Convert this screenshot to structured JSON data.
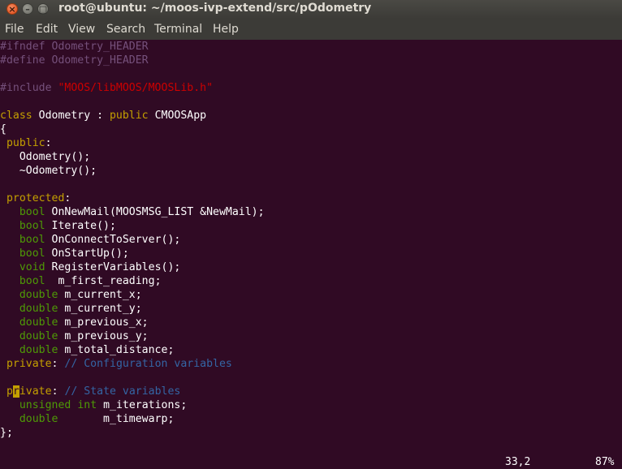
{
  "window": {
    "title": "root@ubuntu: ~/moos-ivp-extend/src/pOdometry",
    "close_glyph": "×",
    "minimize_glyph": "–",
    "maximize_glyph": "□"
  },
  "menu": {
    "file": "File",
    "edit": "Edit",
    "view": "View",
    "search": "Search",
    "terminal": "Terminal",
    "help": "Help"
  },
  "editor": {
    "colors": {
      "background": "#300a24",
      "preprocessor": "#75507b",
      "string": "#cc0000",
      "keyword": "#c4a000",
      "type": "#4e9a06",
      "comment": "#3465a4",
      "text": "#ffffff"
    },
    "lines": [
      [
        {
          "c": "pp",
          "t": "#ifndef Odometry_HEADER"
        }
      ],
      [
        {
          "c": "pp",
          "t": "#define Odometry_HEADER"
        }
      ],
      [],
      [
        {
          "c": "pp",
          "t": "#include "
        },
        {
          "c": "str",
          "t": "\"MOOS/libMOOS/MOOSLib.h\""
        }
      ],
      [],
      [
        {
          "c": "kw",
          "t": "class"
        },
        {
          "c": "",
          "t": " Odometry : "
        },
        {
          "c": "kw",
          "t": "public"
        },
        {
          "c": "",
          "t": " CMOOSApp"
        }
      ],
      [
        {
          "c": "",
          "t": "{"
        }
      ],
      [
        {
          "c": "",
          "t": " "
        },
        {
          "c": "kw",
          "t": "public"
        },
        {
          "c": "",
          "t": ":"
        }
      ],
      [
        {
          "c": "",
          "t": "   Odometry();"
        }
      ],
      [
        {
          "c": "",
          "t": "   ~Odometry();"
        }
      ],
      [],
      [
        {
          "c": "",
          "t": " "
        },
        {
          "c": "kw",
          "t": "protected"
        },
        {
          "c": "",
          "t": ":"
        }
      ],
      [
        {
          "c": "",
          "t": "   "
        },
        {
          "c": "ty",
          "t": "bool"
        },
        {
          "c": "",
          "t": " OnNewMail(MOOSMSG_LIST &NewMail);"
        }
      ],
      [
        {
          "c": "",
          "t": "   "
        },
        {
          "c": "ty",
          "t": "bool"
        },
        {
          "c": "",
          "t": " Iterate();"
        }
      ],
      [
        {
          "c": "",
          "t": "   "
        },
        {
          "c": "ty",
          "t": "bool"
        },
        {
          "c": "",
          "t": " OnConnectToServer();"
        }
      ],
      [
        {
          "c": "",
          "t": "   "
        },
        {
          "c": "ty",
          "t": "bool"
        },
        {
          "c": "",
          "t": " OnStartUp();"
        }
      ],
      [
        {
          "c": "",
          "t": "   "
        },
        {
          "c": "ty",
          "t": "void"
        },
        {
          "c": "",
          "t": " RegisterVariables();"
        }
      ],
      [
        {
          "c": "",
          "t": "   "
        },
        {
          "c": "ty",
          "t": "bool"
        },
        {
          "c": "",
          "t": "  m_first_reading;"
        }
      ],
      [
        {
          "c": "",
          "t": "   "
        },
        {
          "c": "ty",
          "t": "double"
        },
        {
          "c": "",
          "t": " m_current_x;"
        }
      ],
      [
        {
          "c": "",
          "t": "   "
        },
        {
          "c": "ty",
          "t": "double"
        },
        {
          "c": "",
          "t": " m_current_y;"
        }
      ],
      [
        {
          "c": "",
          "t": "   "
        },
        {
          "c": "ty",
          "t": "double"
        },
        {
          "c": "",
          "t": " m_previous_x;"
        }
      ],
      [
        {
          "c": "",
          "t": "   "
        },
        {
          "c": "ty",
          "t": "double"
        },
        {
          "c": "",
          "t": " m_previous_y;"
        }
      ],
      [
        {
          "c": "",
          "t": "   "
        },
        {
          "c": "ty",
          "t": "double"
        },
        {
          "c": "",
          "t": " m_total_distance;"
        }
      ],
      [
        {
          "c": "",
          "t": " "
        },
        {
          "c": "kw",
          "t": "private"
        },
        {
          "c": "",
          "t": ": "
        },
        {
          "c": "cm",
          "t": "// Configuration variables"
        }
      ],
      [],
      [
        {
          "c": "",
          "t": " "
        },
        {
          "c": "kw",
          "t": "p"
        },
        {
          "c": "cursor",
          "t": "r"
        },
        {
          "c": "kw",
          "t": "ivate"
        },
        {
          "c": "",
          "t": ": "
        },
        {
          "c": "cm",
          "t": "// State variables"
        }
      ],
      [
        {
          "c": "",
          "t": "   "
        },
        {
          "c": "ty",
          "t": "unsigned"
        },
        {
          "c": "",
          "t": " "
        },
        {
          "c": "ty",
          "t": "int"
        },
        {
          "c": "",
          "t": " m_iterations;"
        }
      ],
      [
        {
          "c": "",
          "t": "   "
        },
        {
          "c": "ty",
          "t": "double"
        },
        {
          "c": "",
          "t": "       m_timewarp;"
        }
      ],
      [
        {
          "c": "",
          "t": "};"
        }
      ]
    ]
  },
  "status": {
    "ruler": "33,2",
    "percent": "87%"
  }
}
